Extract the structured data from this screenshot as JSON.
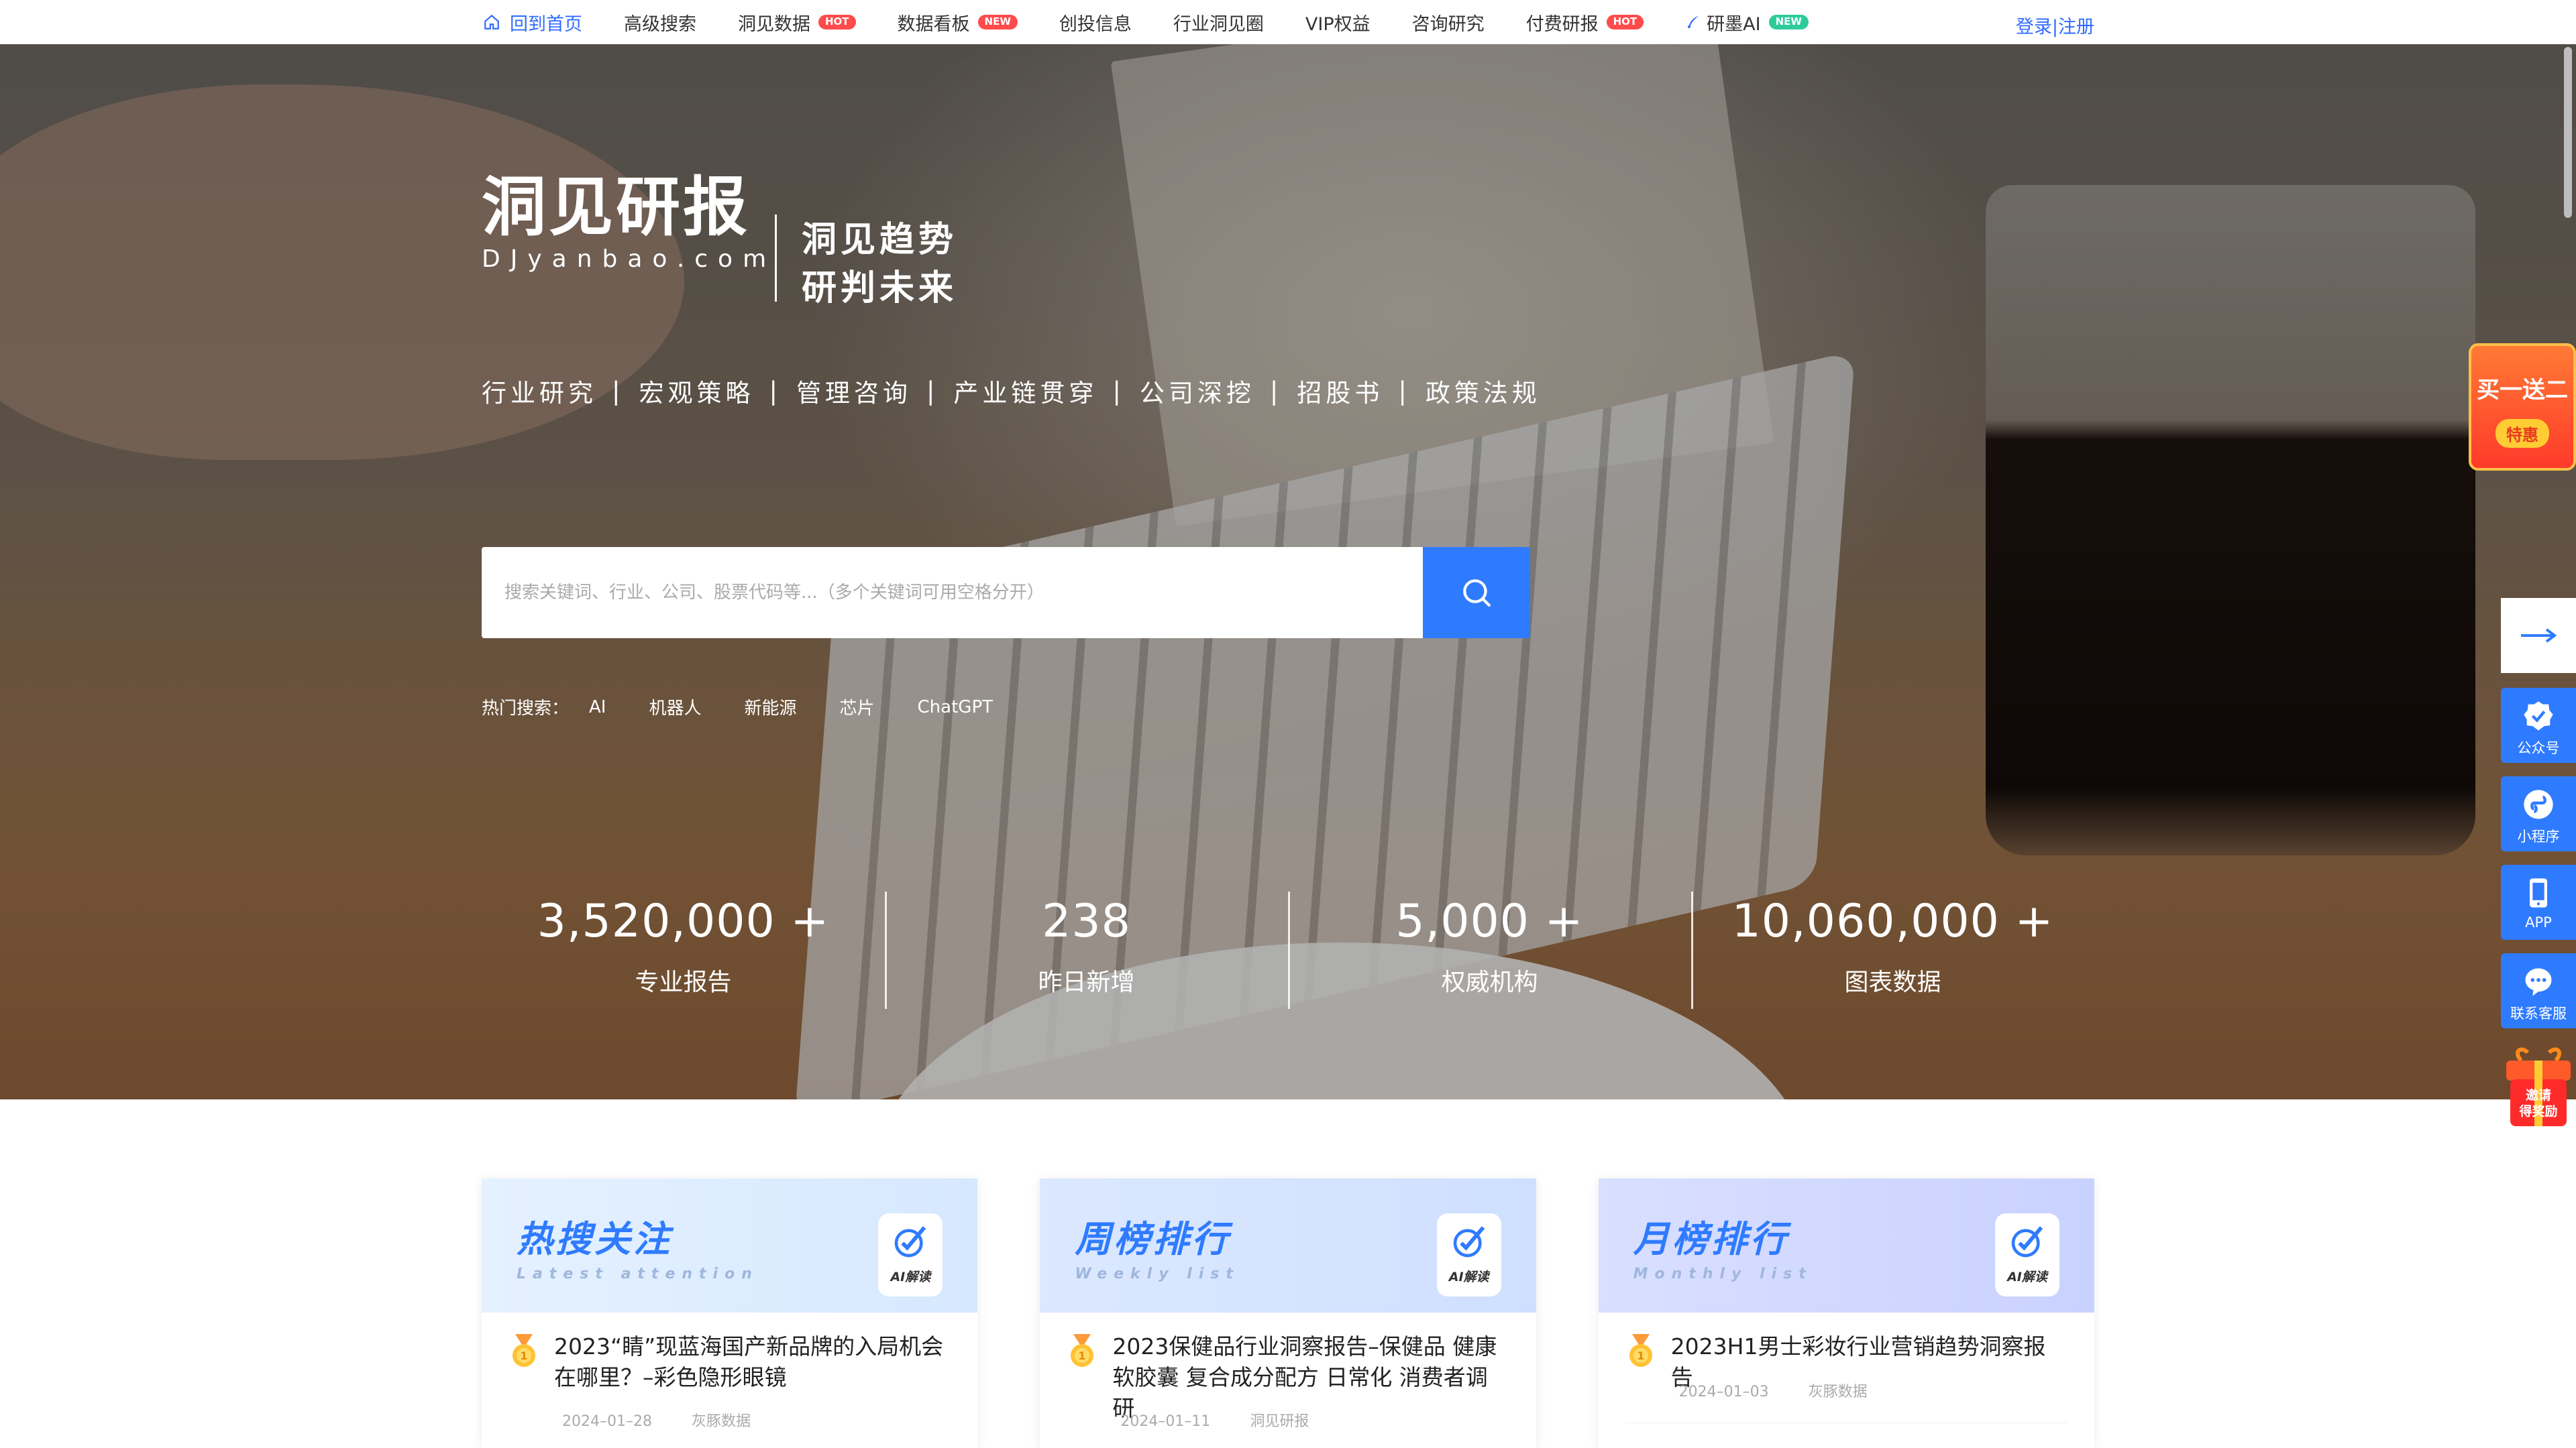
{
  "nav": {
    "items": [
      {
        "label": "回到首页",
        "badge": ""
      },
      {
        "label": "高级搜索",
        "badge": ""
      },
      {
        "label": "洞见数据",
        "badge": "HOT"
      },
      {
        "label": "数据看板",
        "badge": "NEW"
      },
      {
        "label": "创投信息",
        "badge": ""
      },
      {
        "label": "行业洞见圈",
        "badge": ""
      },
      {
        "label": "VIP权益",
        "badge": ""
      },
      {
        "label": "咨询研究",
        "badge": ""
      },
      {
        "label": "付费研报",
        "badge": "HOT"
      },
      {
        "label": "研墨AI",
        "badge": "NEW"
      }
    ],
    "login": "登录|注册"
  },
  "brand": {
    "logo_text": "洞见研报",
    "logo_domain": "DJyanbao.com",
    "slogan_line1": "洞见趋势",
    "slogan_line2": "研判未来"
  },
  "categories": [
    "行业研究",
    "宏观策略",
    "管理咨询",
    "产业链贯穿",
    "公司深挖",
    "招股书",
    "政策法规"
  ],
  "search": {
    "placeholder": "搜索关键词、行业、公司、股票代码等...（多个关键词可用空格分开）",
    "hot_label": "热门搜索：",
    "hot_keywords": [
      "AI",
      "机器人",
      "新能源",
      "芯片",
      "ChatGPT"
    ]
  },
  "stats": [
    {
      "value": "3,520,000 +",
      "label": "专业报告"
    },
    {
      "value": "238",
      "label": "昨日新增"
    },
    {
      "value": "5,000 +",
      "label": "权威机构"
    },
    {
      "value": "10,060,000 +",
      "label": "图表数据"
    }
  ],
  "side": {
    "promo_line1": "买一送二",
    "promo_line2": "特惠",
    "buttons": [
      "公众号",
      "小程序",
      "APP",
      "联系客服"
    ],
    "gift_line1": "邀请",
    "gift_line2": "得奖励"
  },
  "cards": [
    {
      "title": "热搜关注",
      "subtitle": "Latest attention",
      "ai_label": "AI解读",
      "item_title": "2023“睛”现蓝海国产新品牌的入局机会在哪里？–彩色隐形眼镜",
      "item_date": "2024–01–28",
      "item_source": "灰豚数据"
    },
    {
      "title": "周榜排行",
      "subtitle": "Weekly list",
      "ai_label": "AI解读",
      "item_title": "2023保健品行业洞察报告–保健品 健康软胶囊 复合成分配方 日常化 消费者调研",
      "item_date": "2024–01–11",
      "item_source": "洞见研报"
    },
    {
      "title": "月榜排行",
      "subtitle": "Monthly list",
      "ai_label": "AI解读",
      "item_title": "2023H1男士彩妆行业营销趋势洞察报告",
      "item_date": "2024–01–03",
      "item_source": "灰豚数据"
    }
  ],
  "colors": {
    "accent": "#2f7bff",
    "hot_badge": "#ff4b4b",
    "new_badge": "#2ecc9a"
  }
}
